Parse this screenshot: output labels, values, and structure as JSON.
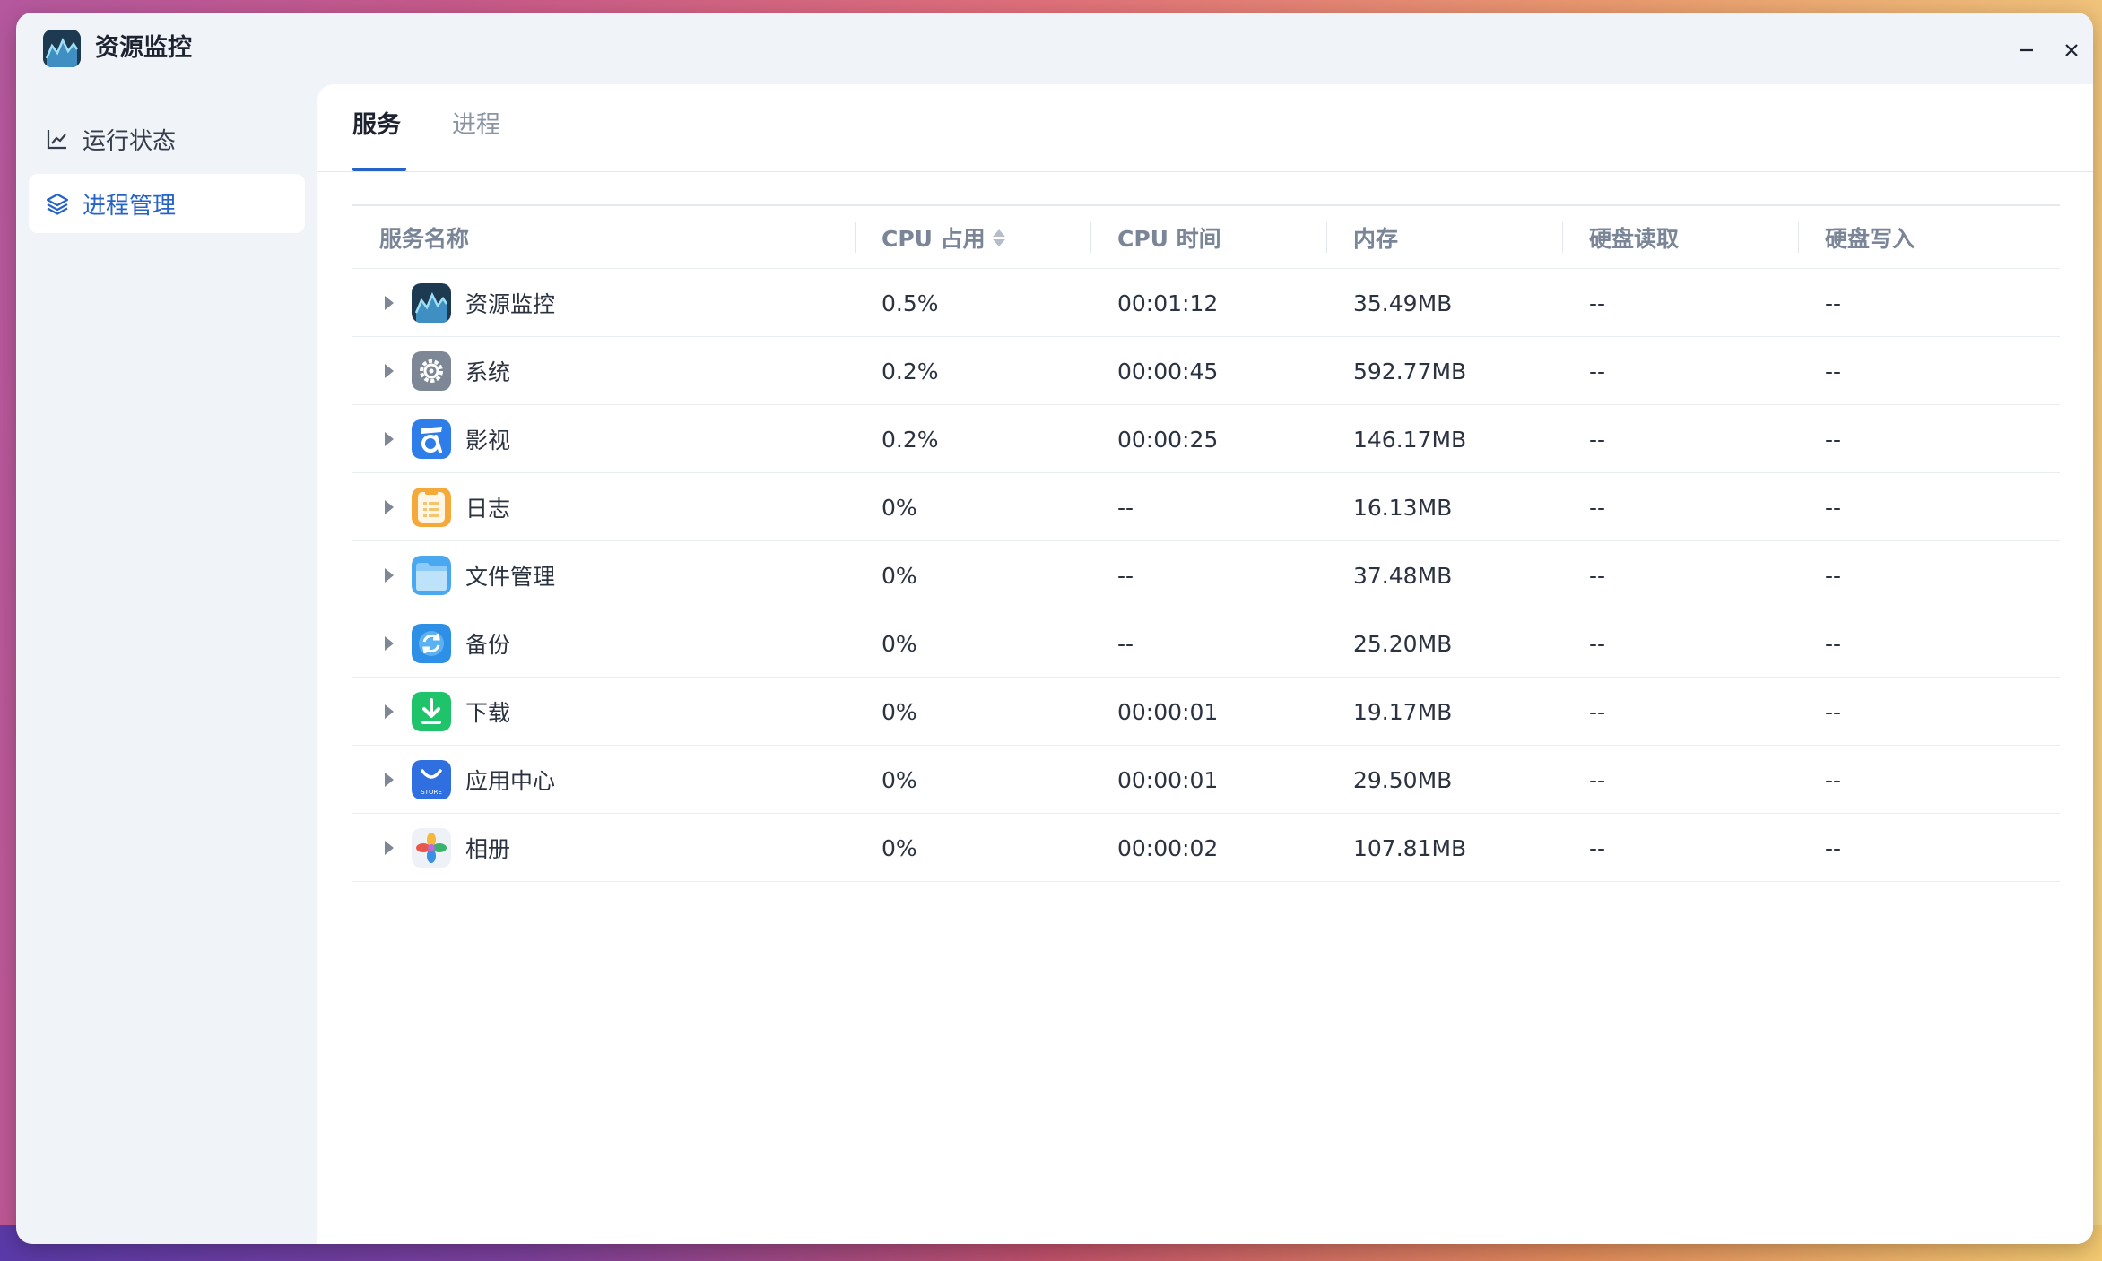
{
  "window": {
    "title": "资源监控"
  },
  "sidebar": {
    "items": [
      {
        "label": "运行状态",
        "icon": "line-chart-icon",
        "active": false
      },
      {
        "label": "进程管理",
        "icon": "layers-icon",
        "active": true
      }
    ]
  },
  "tabs": [
    {
      "label": "服务",
      "active": true
    },
    {
      "label": "进程",
      "active": false
    }
  ],
  "table": {
    "columns": [
      "服务名称",
      "CPU 占用",
      "CPU 时间",
      "内存",
      "硬盘读取",
      "硬盘写入"
    ],
    "rows": [
      {
        "name": "资源监控",
        "icon": "resource-monitor-icon",
        "cpu": "0.5%",
        "cpu_time": "00:01:12",
        "memory": "35.49MB",
        "disk_read": "--",
        "disk_write": "--"
      },
      {
        "name": "系统",
        "icon": "system-gear-icon",
        "cpu": "0.2%",
        "cpu_time": "00:00:45",
        "memory": "592.77MB",
        "disk_read": "--",
        "disk_write": "--"
      },
      {
        "name": "影视",
        "icon": "video-icon",
        "cpu": "0.2%",
        "cpu_time": "00:00:25",
        "memory": "146.17MB",
        "disk_read": "--",
        "disk_write": "--"
      },
      {
        "name": "日志",
        "icon": "log-icon",
        "cpu": "0%",
        "cpu_time": "--",
        "memory": "16.13MB",
        "disk_read": "--",
        "disk_write": "--"
      },
      {
        "name": "文件管理",
        "icon": "folder-icon",
        "cpu": "0%",
        "cpu_time": "--",
        "memory": "37.48MB",
        "disk_read": "--",
        "disk_write": "--"
      },
      {
        "name": "备份",
        "icon": "backup-icon",
        "cpu": "0%",
        "cpu_time": "--",
        "memory": "25.20MB",
        "disk_read": "--",
        "disk_write": "--"
      },
      {
        "name": "下载",
        "icon": "download-icon",
        "cpu": "0%",
        "cpu_time": "00:00:01",
        "memory": "19.17MB",
        "disk_read": "--",
        "disk_write": "--"
      },
      {
        "name": "应用中心",
        "icon": "app-store-icon",
        "store_label": "STORE",
        "cpu": "0%",
        "cpu_time": "00:00:01",
        "memory": "29.50MB",
        "disk_read": "--",
        "disk_write": "--"
      },
      {
        "name": "相册",
        "icon": "photos-icon",
        "cpu": "0%",
        "cpu_time": "00:00:02",
        "memory": "107.81MB",
        "disk_read": "--",
        "disk_write": "--"
      }
    ]
  },
  "colors": {
    "accent": "#2563c8",
    "window_bg": "#f0f3f8",
    "content_bg": "#ffffff"
  }
}
